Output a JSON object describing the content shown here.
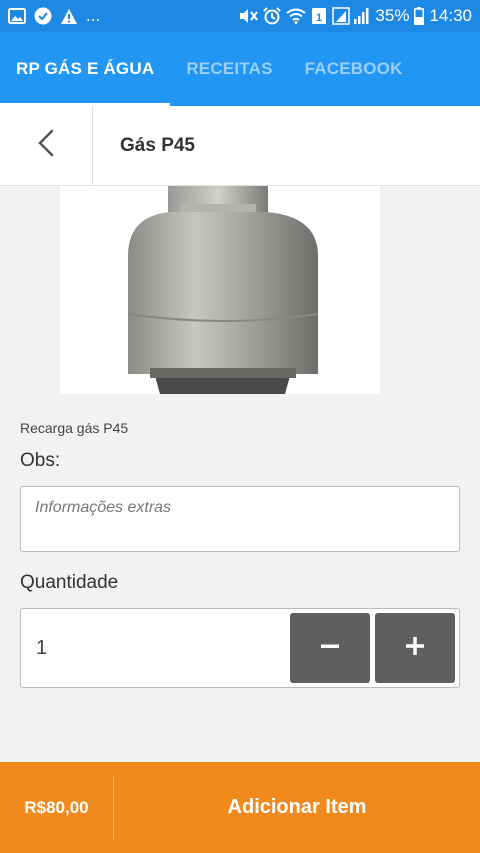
{
  "status_bar": {
    "left_icons": [
      "image-icon",
      "check-circle-icon",
      "warning-icon"
    ],
    "more": "...",
    "right_icons": [
      "mute-vibrate-icon",
      "alarm-icon",
      "wifi-icon",
      "sim-icon",
      "signal-icon"
    ],
    "battery": "35%",
    "time": "14:30"
  },
  "tabs": [
    {
      "label": "RP GÁS E ÁGUA",
      "active": true
    },
    {
      "label": "RECEITAS",
      "active": false
    },
    {
      "label": "FACEBOOK",
      "active": false
    }
  ],
  "header": {
    "title": "Gás P45"
  },
  "product": {
    "description": "Recarga gás P45",
    "obs_label": "Obs:",
    "obs_placeholder": "Informações extras",
    "quantity_label": "Quantidade",
    "quantity_value": "1"
  },
  "footer": {
    "price": "R$80,00",
    "add_label": "Adicionar Item"
  },
  "colors": {
    "primary": "#2196f3",
    "status": "#1e88e5",
    "accent": "#f08a1c",
    "qty_button": "#5f5f5f"
  }
}
